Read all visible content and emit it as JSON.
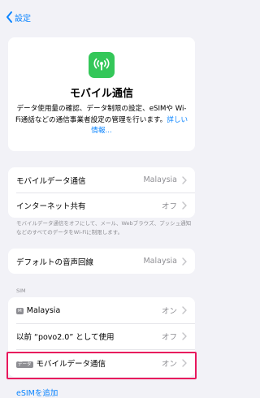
{
  "nav": {
    "back_label": "設定"
  },
  "header": {
    "title": "モバイル通信",
    "description": "データ使用量の確認、データ制限の設定、eSIMや Wi-Fi通話などの通信事業者設定の管理を行います。",
    "link": "詳しい情報..."
  },
  "group1": {
    "rows": [
      {
        "label": "モバイルデータ通信",
        "value": "Malaysia"
      },
      {
        "label": "インターネット共有",
        "value": "オフ"
      }
    ],
    "footnote": "モバイルデータ通信をオフにして、メール、Webブラウズ、プッシュ通知などのすべてのデータをWi-Fiに制限します。"
  },
  "group2": {
    "rows": [
      {
        "label": "デフォルトの音声回線",
        "value": "Malaysia"
      }
    ]
  },
  "sim": {
    "section_label": "SIM",
    "rows": [
      {
        "badge": "M",
        "label": "Malaysia",
        "value": "オン"
      },
      {
        "label": "以前 “povo2.0” として使用",
        "value": "オフ"
      },
      {
        "badge": "データ",
        "label": "モバイルデータ通信",
        "value": "オン"
      }
    ],
    "add_esim": "eSIMを追加"
  },
  "colors": {
    "accent": "#0a84ff",
    "icon_bg": "#34c759",
    "highlight": "#e8175d"
  }
}
